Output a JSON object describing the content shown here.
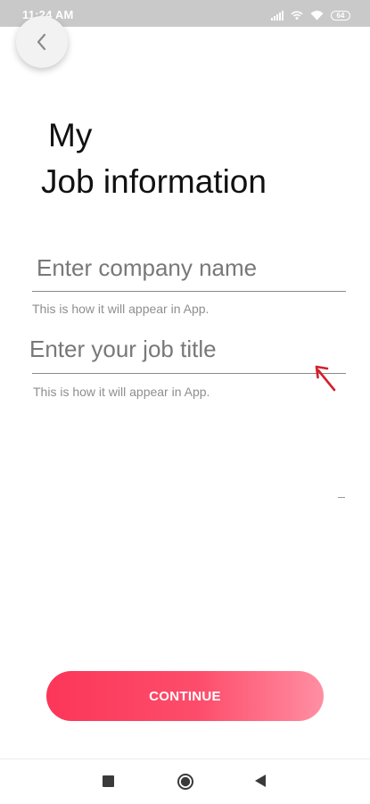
{
  "status_bar": {
    "time": "11:24 AM",
    "battery": "64"
  },
  "header": {
    "back_icon": "chevron-left-icon"
  },
  "title": {
    "line1": "My",
    "line2": "Job information"
  },
  "form": {
    "company": {
      "value": "Enter company name",
      "helper": "This is how it will appear in App."
    },
    "job_title": {
      "value": "Enter your  job title",
      "helper": "This is how it will appear in App."
    }
  },
  "continue_button": {
    "label": "CONTINUE"
  },
  "colors": {
    "accent": "#fc3659",
    "accent_light": "#ff8fa3",
    "annotation_arrow": "#d3202c",
    "status_bar": "#c9c9c9"
  },
  "nav": {
    "recent_icon": "square-icon",
    "home_icon": "circle-home-icon",
    "back_icon": "triangle-back-icon"
  }
}
